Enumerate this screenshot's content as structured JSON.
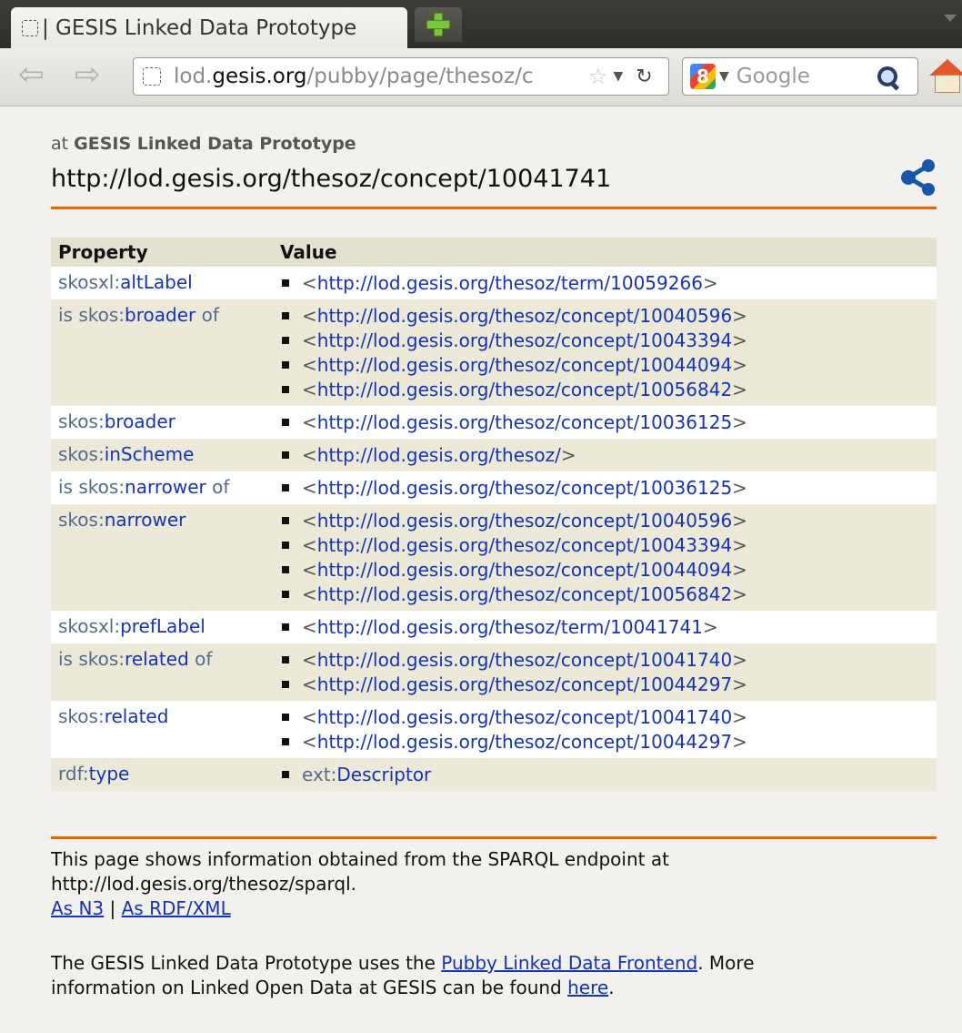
{
  "browser": {
    "tab_title": "| GESIS Linked Data Prototype",
    "url_host_prefix": "lod.",
    "url_host": "gesis.org",
    "url_path": "/pubby/page/thesoz/c",
    "search_engine": "Google",
    "google_letter": "8"
  },
  "header": {
    "at_prefix": "at",
    "site_name": "GESIS Linked Data Prototype",
    "title": "http://lod.gesis.org/thesoz/concept/10041741"
  },
  "table": {
    "col_property": "Property",
    "col_value": "Value",
    "rows": [
      {
        "pre": "",
        "prefix": "skosxl:",
        "local": "altLabel",
        "post": "",
        "values": [
          "http://lod.gesis.org/thesoz/term/10059266"
        ]
      },
      {
        "pre": "is ",
        "prefix": "skos:",
        "local": "broader",
        "post": " of",
        "values": [
          "http://lod.gesis.org/thesoz/concept/10040596",
          "http://lod.gesis.org/thesoz/concept/10043394",
          "http://lod.gesis.org/thesoz/concept/10044094",
          "http://lod.gesis.org/thesoz/concept/10056842"
        ]
      },
      {
        "pre": "",
        "prefix": "skos:",
        "local": "broader",
        "post": "",
        "values": [
          "http://lod.gesis.org/thesoz/concept/10036125"
        ]
      },
      {
        "pre": "",
        "prefix": "skos:",
        "local": "inScheme",
        "post": "",
        "values": [
          "http://lod.gesis.org/thesoz/"
        ]
      },
      {
        "pre": "is ",
        "prefix": "skos:",
        "local": "narrower",
        "post": " of",
        "values": [
          "http://lod.gesis.org/thesoz/concept/10036125"
        ]
      },
      {
        "pre": "",
        "prefix": "skos:",
        "local": "narrower",
        "post": "",
        "values": [
          "http://lod.gesis.org/thesoz/concept/10040596",
          "http://lod.gesis.org/thesoz/concept/10043394",
          "http://lod.gesis.org/thesoz/concept/10044094",
          "http://lod.gesis.org/thesoz/concept/10056842"
        ]
      },
      {
        "pre": "",
        "prefix": "skosxl:",
        "local": "prefLabel",
        "post": "",
        "values": [
          "http://lod.gesis.org/thesoz/term/10041741"
        ]
      },
      {
        "pre": "is ",
        "prefix": "skos:",
        "local": "related",
        "post": " of",
        "values": [
          "http://lod.gesis.org/thesoz/concept/10041740",
          "http://lod.gesis.org/thesoz/concept/10044297"
        ]
      },
      {
        "pre": "",
        "prefix": "skos:",
        "local": "related",
        "post": "",
        "values": [
          "http://lod.gesis.org/thesoz/concept/10041740",
          "http://lod.gesis.org/thesoz/concept/10044297"
        ]
      },
      {
        "pre": "",
        "prefix": "rdf:",
        "local": "type",
        "post": "",
        "qname_value": {
          "prefix": "ext:",
          "local": "Descriptor"
        }
      }
    ]
  },
  "footer": {
    "line1": "This page shows information obtained from the SPARQL endpoint at",
    "line2": "http://lod.gesis.org/thesoz/sparql.",
    "n3_link": "As N3",
    "separator": " | ",
    "rdfxml_link": "As RDF/XML",
    "pubby_before": "The GESIS Linked Data Prototype uses the ",
    "pubby_link": "Pubby Linked Data Frontend",
    "pubby_after": ". More",
    "more_before": "information on Linked Open Data at GESIS can be found ",
    "here_link": "here",
    "more_after": "."
  },
  "colors": {
    "accent_rule": "#f06400",
    "link": "#1533b5",
    "row_shade": "#ece9d8"
  }
}
